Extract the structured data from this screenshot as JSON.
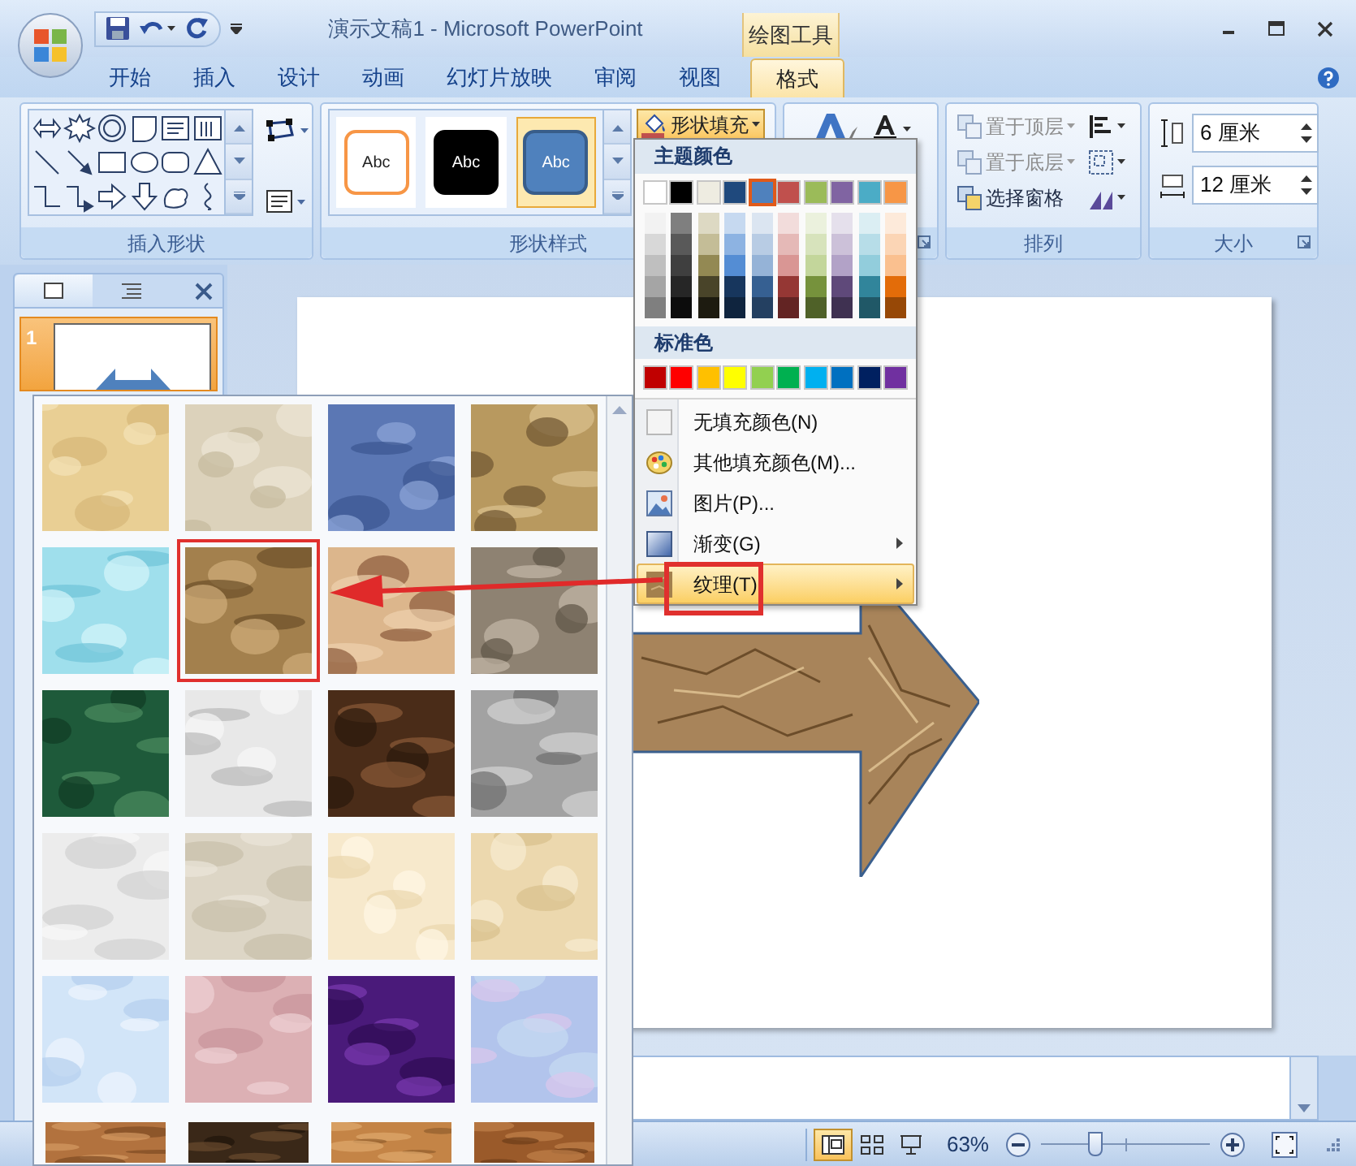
{
  "window": {
    "title": "演示文稿1 - Microsoft PowerPoint",
    "contextual_tab_group": "绘图工具"
  },
  "ribbon_tabs": [
    {
      "label": "开始",
      "selected": false
    },
    {
      "label": "插入",
      "selected": false
    },
    {
      "label": "设计",
      "selected": false
    },
    {
      "label": "动画",
      "selected": false
    },
    {
      "label": "幻灯片放映",
      "selected": false
    },
    {
      "label": "审阅",
      "selected": false
    },
    {
      "label": "视图",
      "selected": false
    },
    {
      "label": "格式",
      "selected": true
    }
  ],
  "ribbon": {
    "insert_shapes": {
      "label": "插入形状"
    },
    "shape_styles": {
      "label": "形状样式",
      "styles": [
        {
          "label": "Abc",
          "kind": "outline",
          "selected": false
        },
        {
          "label": "Abc",
          "kind": "dark",
          "selected": false
        },
        {
          "label": "Abc",
          "kind": "filled",
          "selected": true
        }
      ],
      "fill_button": {
        "label": "形状填充",
        "expanded": true
      }
    },
    "arrange": {
      "label": "排列",
      "items": [
        {
          "label": "置于顶层",
          "disabled": true
        },
        {
          "label": "置于底层",
          "disabled": true
        },
        {
          "label": "选择窗格",
          "disabled": false
        }
      ]
    },
    "size": {
      "label": "大小",
      "height": "6 厘米",
      "width": "12 厘米"
    }
  },
  "fill_menu": {
    "theme_heading": "主题颜色",
    "theme_colors": [
      {
        "color": "#ffffff",
        "selected": false,
        "shades": [
          {
            "color": "#f2f2f2"
          },
          {
            "color": "#d8d8d8"
          },
          {
            "color": "#bfbfbf"
          },
          {
            "color": "#a5a5a5"
          },
          {
            "color": "#7f7f7f"
          }
        ]
      },
      {
        "color": "#000000",
        "selected": false,
        "shades": [
          {
            "color": "#7f7f7f"
          },
          {
            "color": "#595959"
          },
          {
            "color": "#3f3f3f"
          },
          {
            "color": "#262626"
          },
          {
            "color": "#0c0c0c"
          }
        ]
      },
      {
        "color": "#eeece1",
        "selected": false,
        "shades": [
          {
            "color": "#ddd9c3"
          },
          {
            "color": "#c4bd97"
          },
          {
            "color": "#938953"
          },
          {
            "color": "#494429"
          },
          {
            "color": "#1d1b10"
          }
        ]
      },
      {
        "color": "#1f497d",
        "selected": false,
        "shades": [
          {
            "color": "#c6d9f0"
          },
          {
            "color": "#8db3e2"
          },
          {
            "color": "#548dd4"
          },
          {
            "color": "#17365d"
          },
          {
            "color": "#0f243e"
          }
        ]
      },
      {
        "color": "#4f81bd",
        "selected": true,
        "shades": [
          {
            "color": "#dbe5f1"
          },
          {
            "color": "#b8cce4"
          },
          {
            "color": "#95b3d7"
          },
          {
            "color": "#366092"
          },
          {
            "color": "#244061"
          }
        ]
      },
      {
        "color": "#c0504d",
        "selected": false,
        "shades": [
          {
            "color": "#f2dcdb"
          },
          {
            "color": "#e5b9b7"
          },
          {
            "color": "#d99694"
          },
          {
            "color": "#953734"
          },
          {
            "color": "#632423"
          }
        ]
      },
      {
        "color": "#9bbb59",
        "selected": false,
        "shades": [
          {
            "color": "#ebf1dd"
          },
          {
            "color": "#d7e3bc"
          },
          {
            "color": "#c3d69b"
          },
          {
            "color": "#76923c"
          },
          {
            "color": "#4f6128"
          }
        ]
      },
      {
        "color": "#8064a2",
        "selected": false,
        "shades": [
          {
            "color": "#e5e0ec"
          },
          {
            "color": "#ccc1d9"
          },
          {
            "color": "#b2a2c7"
          },
          {
            "color": "#5f497a"
          },
          {
            "color": "#3f3151"
          }
        ]
      },
      {
        "color": "#4bacc6",
        "selected": false,
        "shades": [
          {
            "color": "#dbeef3"
          },
          {
            "color": "#b7dde8"
          },
          {
            "color": "#92cddc"
          },
          {
            "color": "#31859b"
          },
          {
            "color": "#205867"
          }
        ]
      },
      {
        "color": "#f79646",
        "selected": false,
        "shades": [
          {
            "color": "#fdeada"
          },
          {
            "color": "#fbd5b5"
          },
          {
            "color": "#fac08f"
          },
          {
            "color": "#e36c09"
          },
          {
            "color": "#974806"
          }
        ]
      }
    ],
    "standard_heading": "标准色",
    "standard_colors": [
      {
        "color": "#c00000"
      },
      {
        "color": "#ff0000"
      },
      {
        "color": "#ffc000"
      },
      {
        "color": "#ffff00"
      },
      {
        "color": "#92d050"
      },
      {
        "color": "#00b050"
      },
      {
        "color": "#00b0f0"
      },
      {
        "color": "#0070c0"
      },
      {
        "color": "#002060"
      },
      {
        "color": "#7030a0"
      }
    ],
    "items": [
      {
        "label": "无填充颜色(N)",
        "kind": "no-fill",
        "submenu": false,
        "selected": false
      },
      {
        "label": "其他填充颜色(M)...",
        "kind": "more-colors",
        "submenu": false,
        "selected": false
      },
      {
        "label": "图片(P)...",
        "kind": "picture",
        "submenu": false,
        "selected": false
      },
      {
        "label": "渐变(G)",
        "kind": "gradient",
        "submenu": true,
        "selected": false
      },
      {
        "label": "纹理(T)",
        "kind": "texture",
        "submenu": true,
        "selected": true
      }
    ]
  },
  "slides_panel": {
    "slides": [
      {
        "number": "1",
        "selected": true
      }
    ]
  },
  "texture_gallery": {
    "textures": [
      {
        "kind": "picture",
        "selected": false
      },
      {
        "kind": "picture",
        "selected": false
      },
      {
        "kind": "picture",
        "selected": false
      },
      {
        "kind": "picture",
        "selected": false
      },
      {
        "kind": "picture",
        "selected": false
      },
      {
        "kind": "picture",
        "selected": true
      },
      {
        "kind": "picture",
        "selected": false
      },
      {
        "kind": "picture",
        "selected": false
      },
      {
        "kind": "picture",
        "selected": false
      },
      {
        "kind": "picture",
        "selected": false
      },
      {
        "kind": "picture",
        "selected": false
      },
      {
        "kind": "picture",
        "selected": false
      },
      {
        "kind": "picture",
        "selected": false
      },
      {
        "kind": "picture",
        "selected": false
      },
      {
        "kind": "picture",
        "selected": false
      },
      {
        "kind": "picture",
        "selected": false
      },
      {
        "kind": "picture",
        "selected": false
      },
      {
        "kind": "picture",
        "selected": false
      },
      {
        "kind": "picture",
        "selected": false
      },
      {
        "kind": "picture",
        "selected": false
      },
      {
        "kind": "picture",
        "selected": false
      },
      {
        "kind": "picture",
        "selected": false
      },
      {
        "kind": "picture",
        "selected": false
      },
      {
        "kind": "picture",
        "selected": false
      }
    ]
  },
  "status_bar": {
    "views": [
      {
        "kind": "normal",
        "selected": true
      },
      {
        "kind": "sorter",
        "selected": false
      },
      {
        "kind": "show",
        "selected": false
      }
    ],
    "zoom": "63%",
    "zoom_slider": {
      "level": 0.3
    }
  }
}
